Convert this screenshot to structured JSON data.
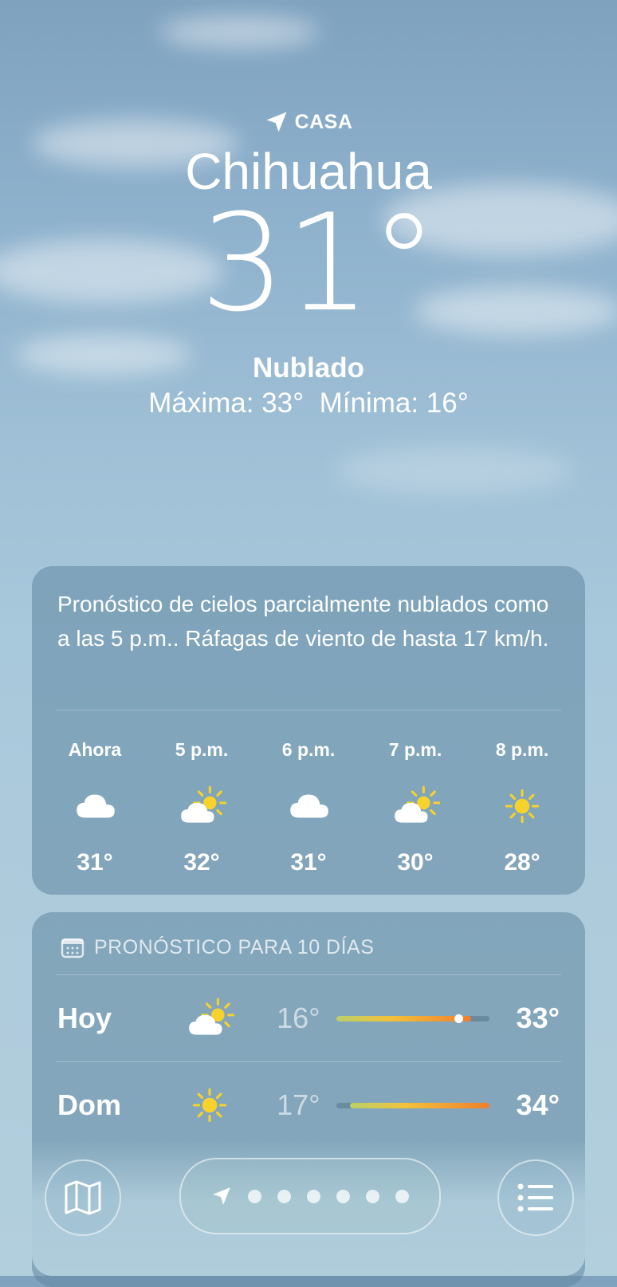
{
  "location": {
    "label": "CASA",
    "city": "Chihuahua",
    "temperature": "31°",
    "condition": "Nublado",
    "high": "Máxima: 33°",
    "low": "Mínima: 16°"
  },
  "hourly": {
    "summary": "Pronóstico de cielos parcialmente nublados como a las 5 p.m.. Ráfagas de viento de hasta 17 km/h.",
    "items": [
      {
        "label": "Ahora",
        "icon": "cloud-icon",
        "temp": "31°"
      },
      {
        "label": "5 p.m.",
        "icon": "partly-sunny-icon",
        "temp": "32°"
      },
      {
        "label": "6 p.m.",
        "icon": "cloud-icon",
        "temp": "31°"
      },
      {
        "label": "7 p.m.",
        "icon": "partly-sunny-icon",
        "temp": "30°"
      },
      {
        "label": "8 p.m.",
        "icon": "sun-icon",
        "temp": "28°"
      }
    ]
  },
  "daily": {
    "title": "PRONÓSTICO PARA 10 DÍAS",
    "days": [
      {
        "day": "Hoy",
        "icon": "partly-sunny-icon",
        "low": "16°",
        "high": "33°",
        "bar_start": 0.0,
        "bar_end": 0.88,
        "current": 0.8
      },
      {
        "day": "Dom",
        "icon": "sun-icon",
        "low": "17°",
        "high": "34°",
        "bar_start": 0.09,
        "bar_end": 1.0
      }
    ]
  },
  "toolbar": {
    "map_icon": "map-icon",
    "list_icon": "list-icon",
    "page_count": 6
  },
  "colors": {
    "sun": "#f6d22a",
    "bar_cool": "#b9d06a",
    "bar_warm": "#f07f2c"
  }
}
